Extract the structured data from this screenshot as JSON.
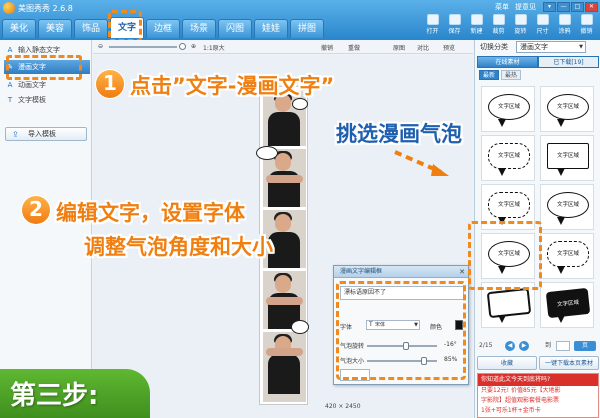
{
  "app": {
    "title": "美图秀秀 2.6.8",
    "links": [
      "菜单",
      "提意见"
    ],
    "window_buttons": [
      "▾",
      "—",
      "□",
      "✕"
    ]
  },
  "nav_tabs": [
    "美化",
    "美容",
    "饰品",
    "文字",
    "边框",
    "场景",
    "闪图",
    "娃娃",
    "拼图"
  ],
  "nav_active": "文字",
  "top_tools": [
    "打开",
    "保存",
    "新建",
    "裁剪",
    "旋转",
    "尺寸",
    "涂鸦",
    "撤销"
  ],
  "left_panel": {
    "items": [
      {
        "icon": "A",
        "label": "输入静态文字"
      },
      {
        "icon": "✎",
        "label": "漫画文字"
      },
      {
        "icon": "A",
        "label": "动画文字"
      },
      {
        "icon": "T",
        "label": "文字模板"
      }
    ],
    "import_label": "导入模板"
  },
  "canvas_toolbar": {
    "zoom_label": "1:1原大",
    "items": [
      "撤销",
      "重做",
      "原图",
      "对比",
      "预览"
    ]
  },
  "canvas": {
    "size_readout": "420 × 2450"
  },
  "dialog": {
    "title": "漫画文字编辑框",
    "close": "✕",
    "text_value": "漂标语原因不了",
    "font_label": "字体",
    "font_value": "宋体",
    "color_label": "颜色",
    "rotate_label": "气泡旋转",
    "rotate_value": "-16°",
    "size_label": "气泡大小",
    "size_value": "85%",
    "rotate_fraction": 0.56,
    "size_fraction": 0.82
  },
  "right_panel": {
    "category_label": "切换分类",
    "category_value": "漫画文字",
    "tabs": [
      "在线素材",
      "已下载[19]"
    ],
    "subtabs": [
      "最新",
      "最热"
    ],
    "bubbles": [
      {
        "text": "文字区域",
        "style": "round"
      },
      {
        "text": "文字区域",
        "style": "round"
      },
      {
        "text": "文字区域",
        "style": "cloud"
      },
      {
        "text": "文字区域",
        "style": "rect"
      },
      {
        "text": "文字区域",
        "style": "cloud"
      },
      {
        "text": "文字区域",
        "style": "round"
      },
      {
        "text": "文字区域",
        "style": "round"
      },
      {
        "text": "文字区域",
        "style": "cloud"
      },
      {
        "text": "",
        "style": "spiky"
      },
      {
        "text": "文字区域",
        "style": "spiky"
      }
    ],
    "pager": {
      "page": "2/15",
      "goto": "到",
      "go": "页"
    },
    "actions": [
      "收藏",
      "一键下载本页素材"
    ],
    "ad": {
      "head": "你知道此文今天到底将吗?",
      "lines": [
        "只要12元! 价值85元【大地影",
        "字影院】超值观影套餐电影票",
        "1张+可乐1杯+金币卡"
      ]
    }
  },
  "annotations": {
    "step1_num": "1",
    "step1_text": "点击”文字-漫画文字”",
    "pick_text": "挑选漫画气泡",
    "step2_num": "2",
    "step2_line1": "编辑文字，设置字体",
    "step2_line2": "调整气泡角度和大小",
    "step_badge": "第三步:"
  },
  "colors": {
    "accent_orange": "#f07f12",
    "accent_blue": "#1f5fb0",
    "titlebar_blue": "#2a86cc",
    "step_green": "#4fa428"
  }
}
